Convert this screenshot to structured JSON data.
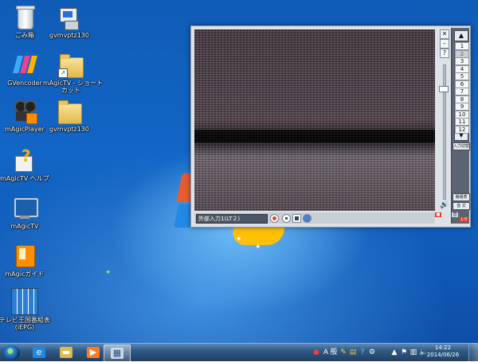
{
  "desktop": {
    "icons": [
      {
        "label": "ごみ箱",
        "icon": "recycle-bin-icon"
      },
      {
        "label": "gvmvptz130",
        "icon": "installer-icon"
      },
      {
        "label": "GVencoder",
        "icon": "gvencoder-icon"
      },
      {
        "label": "mAgicTV - ショート",
        "label2": "カット",
        "icon": "folder-shortcut-icon"
      },
      {
        "label": "mAgicPlayer",
        "icon": "magicplayer-icon"
      },
      {
        "label": "gvmvptz130",
        "icon": "folder-icon"
      },
      {
        "label": "mAgicTV ヘルプ",
        "icon": "help-icon"
      },
      {
        "label": "mAgicTV",
        "icon": "magictv-icon"
      },
      {
        "label": "mAgicガイド",
        "icon": "magicguide-icon"
      },
      {
        "label": "テレビ王国番組表",
        "label2": "(iEPG)",
        "icon": "tv-guide-icon"
      }
    ]
  },
  "tv_window": {
    "input_label": "外部入力1(LT２)",
    "buttons": {
      "close": "✕",
      "minimize": "–",
      "help": "?"
    },
    "channel_up": "▲",
    "channel_down": "▼",
    "channels": [
      "1",
      "2",
      "3",
      "4",
      "5",
      "6",
      "7",
      "8",
      "9",
      "10",
      "11",
      "12"
    ],
    "selected_channel": "2",
    "input_switch_label": "入力切替",
    "bottom_buttons": [
      "番組表",
      "音 ⽂"
    ],
    "mini_labels": [
      "■",
      "⾳",
      "L·V"
    ],
    "volume_level": 0.82
  },
  "taskbar": {
    "apps": [
      {
        "icon": "ie-icon",
        "glyph": "e"
      },
      {
        "icon": "explorer-icon",
        "glyph": "▬"
      },
      {
        "icon": "media-player-icon",
        "glyph": "▶"
      },
      {
        "icon": "magictv-taskbar-icon",
        "glyph": "▦"
      }
    ],
    "tray": {
      "ime_mode": "A",
      "ime_label": "般"
    },
    "clock": {
      "time": "14:22",
      "date": "2014/06/26"
    }
  },
  "colors": {
    "accent": "#1266c6",
    "taskbar": "#2f5a86",
    "rec": "#e8402a"
  }
}
